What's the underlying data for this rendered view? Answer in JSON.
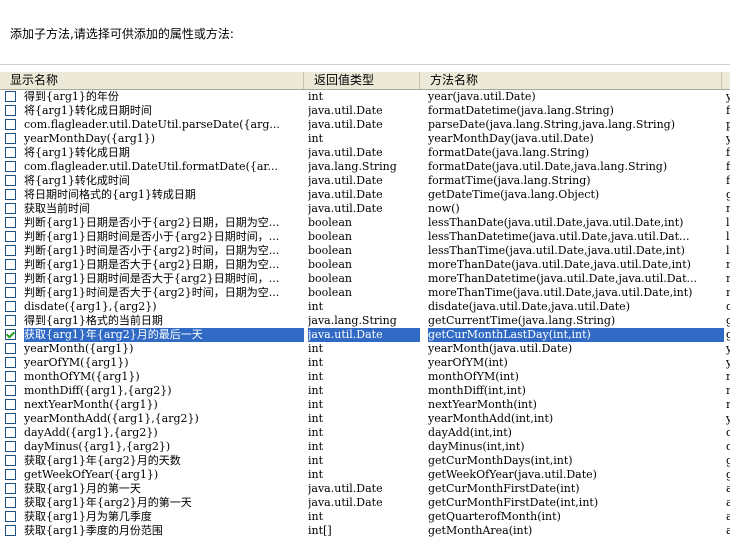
{
  "prompt": "添加子方法,请选择可供添加的属性或方法:",
  "columns": [
    "显示名称",
    "返回值类型",
    "方法名称"
  ],
  "rows": [
    {
      "name": "得到{arg1}的年份",
      "type": "int",
      "method": "year(java.util.Date)",
      "extra": "y",
      "checked": false
    },
    {
      "name": "将{arg1}转化成日期时间",
      "type": "java.util.Date",
      "method": "formatDatetime(java.lang.String)",
      "extra": "f",
      "checked": false
    },
    {
      "name": "com.flagleader.util.DateUtil.parseDate({arg...",
      "type": "java.util.Date",
      "method": "parseDate(java.lang.String,java.lang.String)",
      "extra": "p",
      "checked": false
    },
    {
      "name": "yearMonthDay({arg1})",
      "type": "int",
      "method": "yearMonthDay(java.util.Date)",
      "extra": "y",
      "checked": false
    },
    {
      "name": "将{arg1}转化成日期",
      "type": "java.util.Date",
      "method": "formatDate(java.lang.String)",
      "extra": "f",
      "checked": false
    },
    {
      "name": "com.flagleader.util.DateUtil.formatDate({ar...",
      "type": "java.lang.String",
      "method": "formatDate(java.util.Date,java.lang.String)",
      "extra": "f",
      "checked": false
    },
    {
      "name": "将{arg1}转化成时间",
      "type": "java.util.Date",
      "method": "formatTime(java.lang.String)",
      "extra": "f",
      "checked": false
    },
    {
      "name": "将日期时间格式的{arg1}转成日期",
      "type": "java.util.Date",
      "method": "getDateTime(java.lang.Object)",
      "extra": "g",
      "checked": false
    },
    {
      "name": "获取当前时间",
      "type": "java.util.Date",
      "method": "now()",
      "extra": "n",
      "checked": false
    },
    {
      "name": "判断{arg1}日期是否小于{arg2}日期，日期为空...",
      "type": "boolean",
      "method": "lessThanDate(java.util.Date,java.util.Date,int)",
      "extra": "l",
      "checked": false
    },
    {
      "name": "判断{arg1}日期时间是否小于{arg2}日期时间，...",
      "type": "boolean",
      "method": "lessThanDatetime(java.util.Date,java.util.Dat...",
      "extra": "l",
      "checked": false
    },
    {
      "name": "判断{arg1}时间是否小于{arg2}时间，日期为空...",
      "type": "boolean",
      "method": "lessThanTime(java.util.Date,java.util.Date,int)",
      "extra": "l",
      "checked": false
    },
    {
      "name": "判断{arg1}日期是否大于{arg2}日期，日期为空...",
      "type": "boolean",
      "method": "moreThanDate(java.util.Date,java.util.Date,int)",
      "extra": "m",
      "checked": false
    },
    {
      "name": "判断{arg1}日期时间是否大于{arg2}日期时间，...",
      "type": "boolean",
      "method": "moreThanDatetime(java.util.Date,java.util.Dat...",
      "extra": "m",
      "checked": false
    },
    {
      "name": "判断{arg1}时间是否大于{arg2}时间，日期为空...",
      "type": "boolean",
      "method": "moreThanTime(java.util.Date,java.util.Date,int)",
      "extra": "m",
      "checked": false
    },
    {
      "name": "disdate({arg1},{arg2})",
      "type": "int",
      "method": "disdate(java.util.Date,java.util.Date)",
      "extra": "d",
      "checked": false
    },
    {
      "name": "得到{arg1}格式的当前日期",
      "type": "java.lang.String",
      "method": "getCurrentTime(java.lang.String)",
      "extra": "g",
      "checked": false
    },
    {
      "name": "获取{arg1}年{arg2}月的最后一天",
      "type": "java.util.Date",
      "method": "getCurMonthLastDay(int,int)",
      "extra": "g",
      "checked": true
    },
    {
      "name": "yearMonth({arg1})",
      "type": "int",
      "method": "yearMonth(java.util.Date)",
      "extra": "y",
      "checked": false
    },
    {
      "name": "yearOfYM({arg1})",
      "type": "int",
      "method": "yearOfYM(int)",
      "extra": "y",
      "checked": false
    },
    {
      "name": "monthOfYM({arg1})",
      "type": "int",
      "method": "monthOfYM(int)",
      "extra": "m",
      "checked": false
    },
    {
      "name": "monthDiff({arg1},{arg2})",
      "type": "int",
      "method": "monthDiff(int,int)",
      "extra": "m",
      "checked": false
    },
    {
      "name": "nextYearMonth({arg1})",
      "type": "int",
      "method": "nextYearMonth(int)",
      "extra": "n",
      "checked": false
    },
    {
      "name": "yearMonthAdd({arg1},{arg2})",
      "type": "int",
      "method": "yearMonthAdd(int,int)",
      "extra": "y",
      "checked": false
    },
    {
      "name": "dayAdd({arg1},{arg2})",
      "type": "int",
      "method": "dayAdd(int,int)",
      "extra": "d",
      "checked": false
    },
    {
      "name": "dayMinus({arg1},{arg2})",
      "type": "int",
      "method": "dayMinus(int,int)",
      "extra": "d",
      "checked": false
    },
    {
      "name": "获取{arg1}年{arg2}月的天数",
      "type": "int",
      "method": "getCurMonthDays(int,int)",
      "extra": "g",
      "checked": false
    },
    {
      "name": "getWeekOfYear({arg1})",
      "type": "int",
      "method": "getWeekOfYear(java.util.Date)",
      "extra": "g",
      "checked": false
    },
    {
      "name": "获取{arg1}月的第一天",
      "type": "java.util.Date",
      "method": "getCurMonthFirstDate(int)",
      "extra": "a",
      "checked": false
    },
    {
      "name": "获取{arg1}年{arg2}月的第一天",
      "type": "java.util.Date",
      "method": "getCurMonthFirstDate(int,int)",
      "extra": "a",
      "checked": false
    },
    {
      "name": "获取{arg1}月为第几季度",
      "type": "int",
      "method": "getQuarterofMonth(int)",
      "extra": "a",
      "checked": false
    },
    {
      "name": "获取{arg1}季度的月份范围",
      "type": "int[]",
      "method": "getMonthArea(int)",
      "extra": "a",
      "checked": false
    }
  ]
}
